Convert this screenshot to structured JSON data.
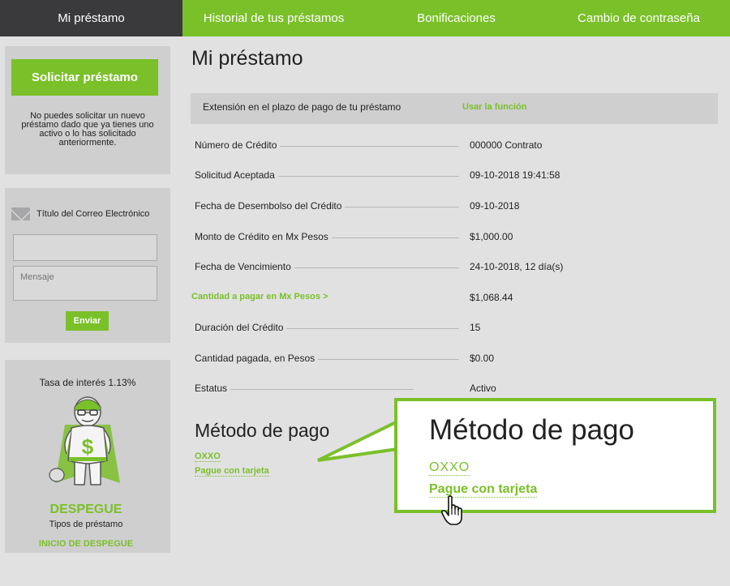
{
  "nav": {
    "items": [
      {
        "label": "Mi préstamo"
      },
      {
        "label": "Historial de tus préstamos"
      },
      {
        "label": "Bonificaciones"
      },
      {
        "label": "Cambio de contraseña"
      }
    ]
  },
  "sidebar": {
    "apply_button": "Solicitar préstamo",
    "apply_note": "No puedes solicitar un nuevo préstamo dado que ya tienes uno activo o lo has solicitado anteriormente.",
    "email_title": "Título del Correo Electrónico",
    "message_placeholder": "Mensaje",
    "send_button": "Enviar",
    "rate": "Tasa de interés 1.13%",
    "brand_name": "DESPEGUE",
    "brand_sub": "Tipos de préstamo",
    "brand_link": "INICIO DE DESPEGUE"
  },
  "main": {
    "title": "Mi préstamo",
    "extension_label": "Extensión en el plazo de pago de tu préstamo",
    "extension_link": "Usar la función",
    "rows": [
      {
        "label": "Número de Crédito",
        "value": "000000 Contrato"
      },
      {
        "label": "Solicitud Aceptada",
        "value": "09-10-2018 19:41:58"
      },
      {
        "label": "Fecha de Desembolso del Crédito",
        "value": "09-10-2018"
      },
      {
        "label": "Monto de Crédito en Mx Pesos",
        "value": "$1,000.00"
      },
      {
        "label": "Fecha de Vencimiento",
        "value": "24-10-2018, 12 día(s)"
      },
      {
        "label": "Cantidad a pagar en Mx Pesos >",
        "value": "$1,068.44"
      },
      {
        "label": "Duración del Crédito",
        "value": "15"
      },
      {
        "label": "Cantidad pagada, en Pesos",
        "value": "$0.00"
      },
      {
        "label": "Estatus",
        "value": "Activo"
      }
    ],
    "payment_title": "Método de pago",
    "payment_oxxo": "OXXO",
    "payment_card": "Pague con tarjeta"
  },
  "callout": {
    "title": "Método de pago",
    "oxxo": "OXXO",
    "card": "Pague con tarjeta"
  },
  "colors": {
    "accent": "#7ac029",
    "nav_active": "#3a3a3c",
    "background": "#e1e1e2",
    "panel": "#cfcfd0"
  }
}
